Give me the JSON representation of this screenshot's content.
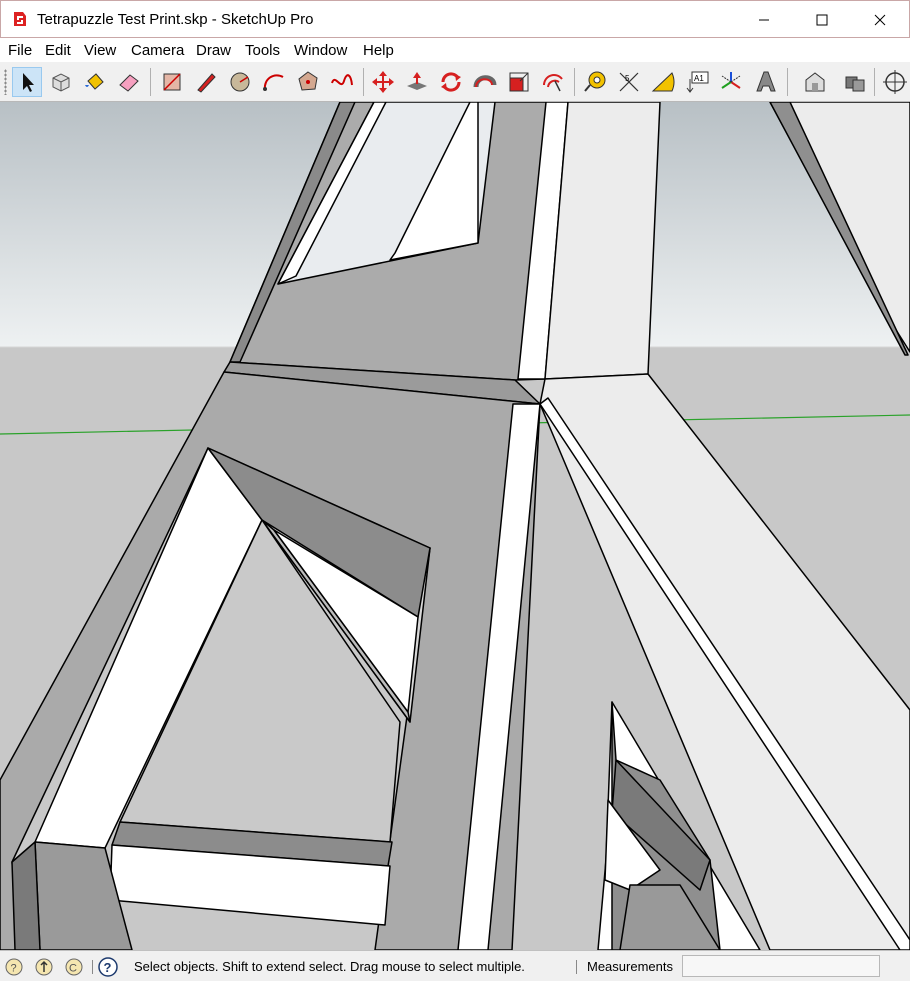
{
  "window": {
    "title": "Tetrapuzzle Test Print.skp - SketchUp Pro",
    "app_icon": "sketchup-logo-icon"
  },
  "menu": [
    "File",
    "Edit",
    "View",
    "Camera",
    "Draw",
    "Tools",
    "Window",
    "Help"
  ],
  "toolbar": {
    "tools": [
      "select-arrow-icon",
      "make-component-icon",
      "paint-bucket-icon",
      "eraser-icon",
      "rectangle-icon",
      "line-pencil-icon",
      "circle-icon",
      "arc-icon",
      "polygon-icon",
      "freehand-icon",
      "move-icon",
      "push-pull-icon",
      "rotate-icon",
      "follow-me-icon",
      "scale-icon",
      "offset-icon",
      "tape-measure-icon",
      "dimension-icon",
      "protractor-icon",
      "text-icon",
      "axes-icon",
      "3d-text-icon",
      "warehouse-icon",
      "extension-warehouse-icon",
      "orbit-icon"
    ]
  },
  "status": {
    "message": "Select objects. Shift to extend select. Drag mouse to select multiple.",
    "measurements_label": "Measurements",
    "measurements_value": ""
  }
}
